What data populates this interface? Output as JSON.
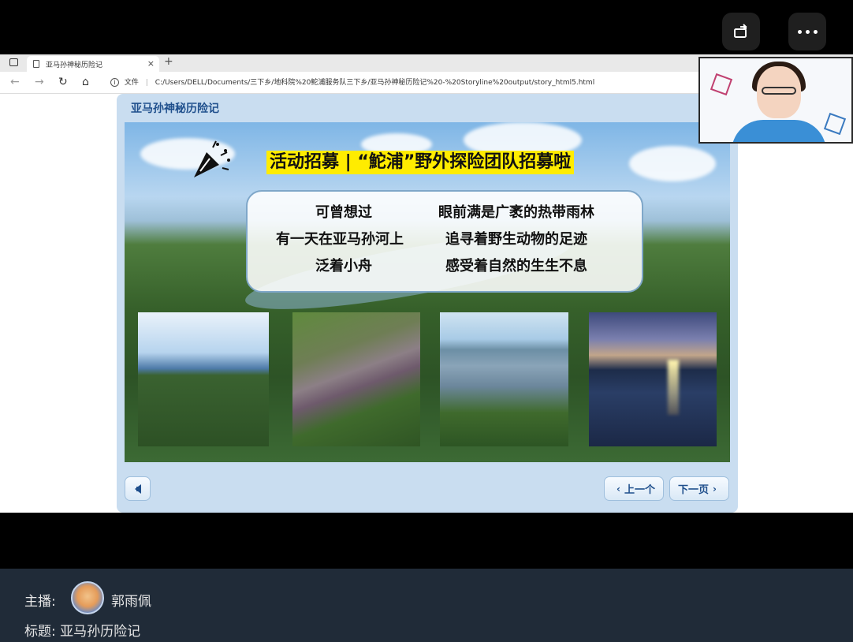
{
  "overlay": {
    "rotate_icon": "rotate-screen-icon",
    "more_icon": "more-dots-icon"
  },
  "browser": {
    "tab_title": "亚马孙神秘历险记",
    "tab_close": "×",
    "new_tab": "+",
    "address_prefix": "文件",
    "address_url": "C:/Users/DELL/Documents/三下乡/地科院%20鮀浦服务队三下乡/亚马孙神秘历险记%20-%20Storyline%20output/story_html5.html"
  },
  "player": {
    "title": "亚马孙神秘历险记",
    "headline": "活动招募 | “鮀浦”野外探险团队招募啦",
    "poem": {
      "left": [
        "可曾想过",
        "有一天在亚马孙河上",
        "泛着小舟"
      ],
      "right": [
        "眼前满是广袤的热带雨林",
        "追寻着野生动物的足迹",
        "感受着自然的生生不息"
      ]
    },
    "prev_label": "上一个",
    "next_label": "下一页"
  },
  "stream_info": {
    "host_label": "主播:",
    "host_name": "郭雨佩",
    "title_label": "标题:",
    "title_value": "亚马孙历险记"
  }
}
